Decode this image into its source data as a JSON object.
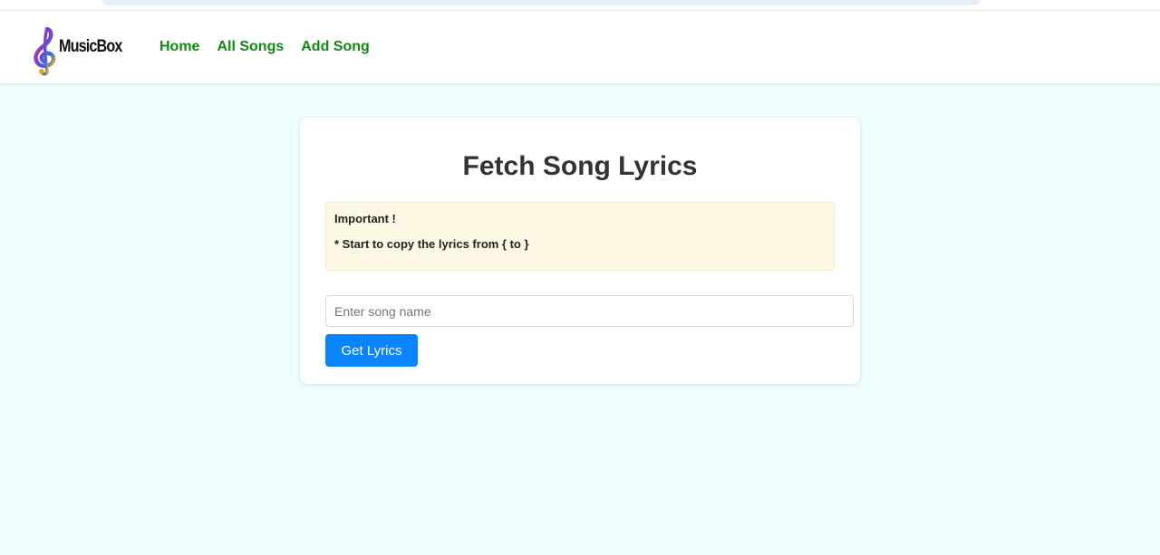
{
  "brand": {
    "name": "MusicBox",
    "logo_icon": "treble-clef-icon",
    "colors": {
      "nav_link": "#118a11",
      "button": "#0a84ff",
      "notice_bg": "#fef9e4",
      "page_bg": "#eefefe"
    }
  },
  "nav": {
    "items": [
      {
        "label": "Home"
      },
      {
        "label": "All Songs"
      },
      {
        "label": "Add Song"
      }
    ]
  },
  "main": {
    "title": "Fetch Song Lyrics",
    "notice": {
      "heading": "Important !",
      "line": "* Start to copy the lyrics from { to }"
    },
    "search": {
      "value": "",
      "placeholder": "Enter song name"
    },
    "submit_label": "Get Lyrics"
  }
}
